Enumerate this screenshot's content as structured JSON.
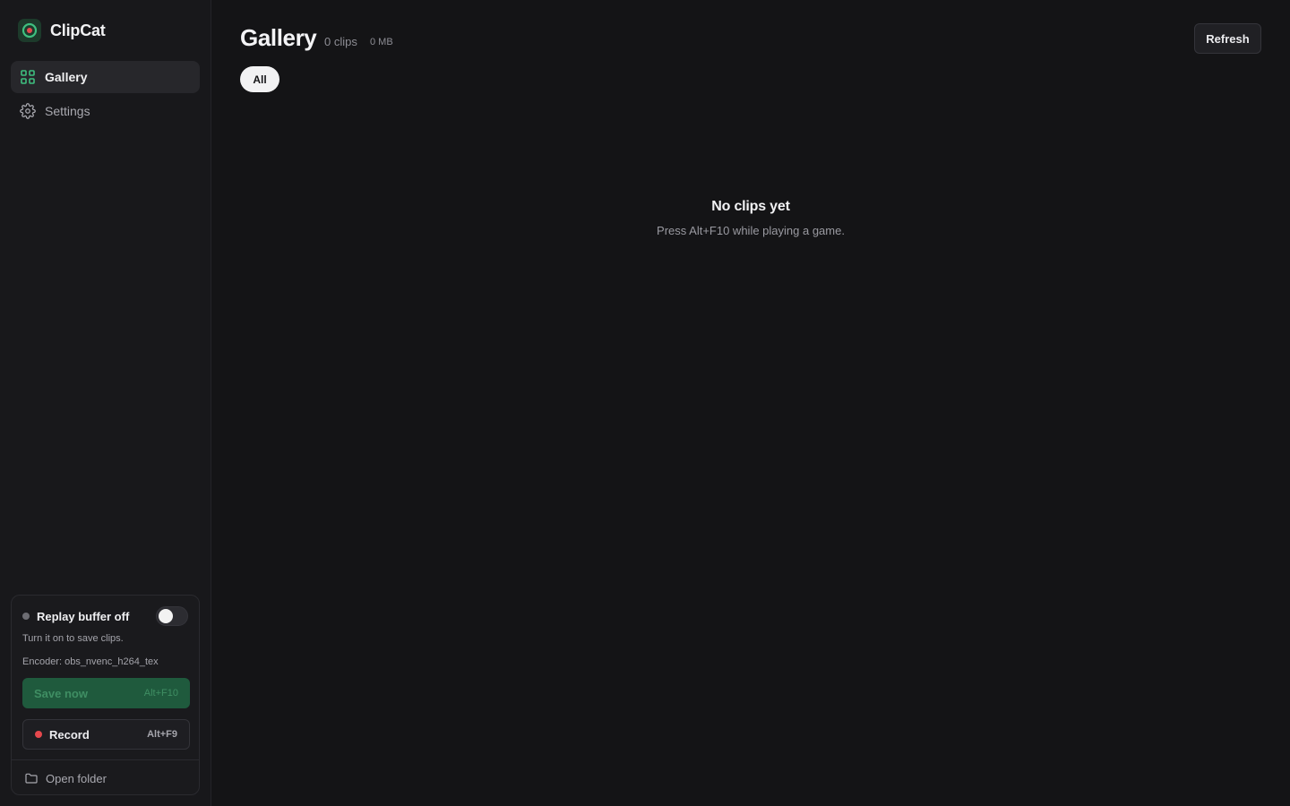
{
  "app": {
    "name": "ClipCat"
  },
  "colors": {
    "accent": "#3fbf7f",
    "record": "#e5484d",
    "background": "#141416"
  },
  "sidebar": {
    "items": [
      {
        "label": "Gallery",
        "icon": "grid-icon",
        "active": true
      },
      {
        "label": "Settings",
        "icon": "gear-icon",
        "active": false
      }
    ]
  },
  "replay": {
    "title": "Replay buffer off",
    "enabled": false,
    "subtitle": "Turn it on to save clips.",
    "encoder": "Encoder: obs_nvenc_h264_tex",
    "save_label": "Save now",
    "save_shortcut": "Alt+F10",
    "record_label": "Record",
    "record_shortcut": "Alt+F9",
    "open_folder_label": "Open folder"
  },
  "main": {
    "title": "Gallery",
    "clip_count": "0 clips",
    "size": "0 MB",
    "refresh_label": "Refresh",
    "filters": [
      "All"
    ],
    "empty_title": "No clips yet",
    "empty_subtitle": "Press Alt+F10 while playing a game."
  }
}
